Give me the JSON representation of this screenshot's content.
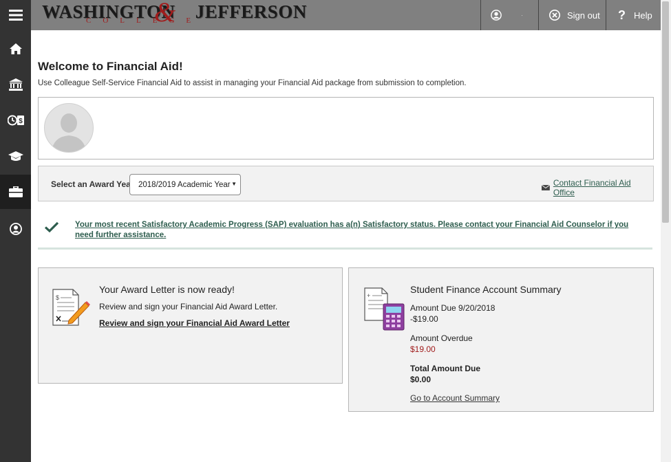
{
  "header": {
    "logo_main": "WASHINGTON JEFFERSON",
    "logo_amp": "&",
    "logo_sub": "COLLEGE",
    "user_menu_label": "·",
    "sign_out_label": "Sign out",
    "help_label": "Help"
  },
  "sidebar": {
    "items": [
      {
        "name": "menu",
        "icon": "hamburger-icon"
      },
      {
        "name": "home",
        "icon": "home-icon"
      },
      {
        "name": "finance",
        "icon": "bank-icon"
      },
      {
        "name": "financial-aid",
        "icon": "clock-dollar-icon"
      },
      {
        "name": "academics",
        "icon": "graduation-cap-icon"
      },
      {
        "name": "employment",
        "icon": "briefcase-icon"
      },
      {
        "name": "profile",
        "icon": "user-circle-icon"
      }
    ]
  },
  "page": {
    "title": "Welcome to Financial Aid!",
    "subtitle": "Use Colleague Self-Service Financial Aid to assist in managing your Financial Aid package from submission to completion."
  },
  "award_year": {
    "label": "Select an Award Year:",
    "selected": "2018/2019 Academic Year",
    "contact_link": "Contact Financial Aid Office"
  },
  "sap": {
    "message": "Your most recent Satisfactory Academic Progress (SAP) evaluation has a(n) Satisfactory status. Please contact your Financial Aid Counselor if you need further assistance."
  },
  "award_letter": {
    "title": "Your Award Letter is now ready!",
    "description": "Review and sign your Financial Aid Award Letter.",
    "link": "Review and sign your Financial Aid Award Letter"
  },
  "account_summary": {
    "title": "Student Finance Account Summary",
    "amount_due_label": "Amount Due 9/20/2018",
    "amount_due_value": "-$19.00",
    "amount_overdue_label": "Amount Overdue",
    "amount_overdue_value": "$19.00",
    "total_due_label": "Total Amount Due",
    "total_due_value": "$0.00",
    "link": "Go to Account Summary"
  },
  "colors": {
    "sidebar": "#333333",
    "topbar": "#808080",
    "link": "#2e5d4e",
    "overdue": "#a01c1c"
  }
}
